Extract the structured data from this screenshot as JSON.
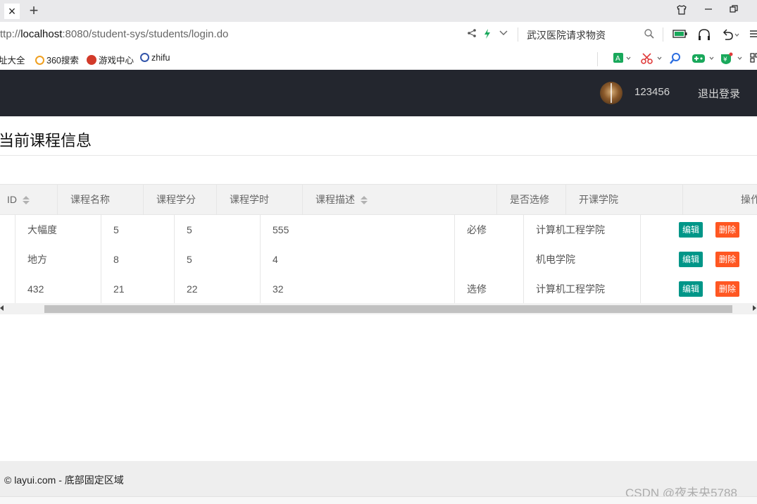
{
  "browser": {
    "tab_close_glyph": "×",
    "new_tab_glyph": "+",
    "url_prefix": "ttp://",
    "url_host": "localhost",
    "url_rest": ":8080/student-sys/students/login.do",
    "search_text": "武汉医院请求物资",
    "bookmarks": [
      {
        "label": "址大全",
        "icon_color": "#cc3333"
      },
      {
        "label": "360搜索",
        "icon_color": "#f0a020"
      },
      {
        "label": "游戏中心",
        "icon_color": "#d23a2a"
      },
      {
        "label": "zhifu",
        "icon_color": "#3355aa"
      }
    ]
  },
  "header": {
    "username": "123456",
    "logout_label": "退出登录"
  },
  "page": {
    "title": "当前课程信息"
  },
  "table": {
    "columns": [
      {
        "label": "ID",
        "sortable": true
      },
      {
        "label": "课程名称",
        "sortable": false
      },
      {
        "label": "课程学分",
        "sortable": false
      },
      {
        "label": "课程学时",
        "sortable": false
      },
      {
        "label": "课程描述",
        "sortable": true
      },
      {
        "label": "是否选修",
        "sortable": false
      },
      {
        "label": "开课学院",
        "sortable": false
      },
      {
        "label": "操作",
        "sortable": false
      }
    ],
    "rows": [
      {
        "name": "大幅度",
        "credit": "5",
        "hours": "5",
        "desc": "555",
        "elective": "必修",
        "college": "计算机工程学院"
      },
      {
        "name": "地方",
        "credit": "8",
        "hours": "5",
        "desc": "4",
        "elective": "",
        "college": "机电学院"
      },
      {
        "name": "432",
        "credit": "21",
        "hours": "22",
        "desc": "32",
        "elective": "选修",
        "college": "计算机工程学院"
      }
    ],
    "edit_label": "编辑",
    "delete_label": "删除"
  },
  "footer": {
    "text": "© layui.com - 底部固定区域"
  },
  "watermark": "CSDN @夜未央5788",
  "colors": {
    "header_bg": "#23262e",
    "edit_btn": "#009688",
    "delete_btn": "#ff5722"
  }
}
